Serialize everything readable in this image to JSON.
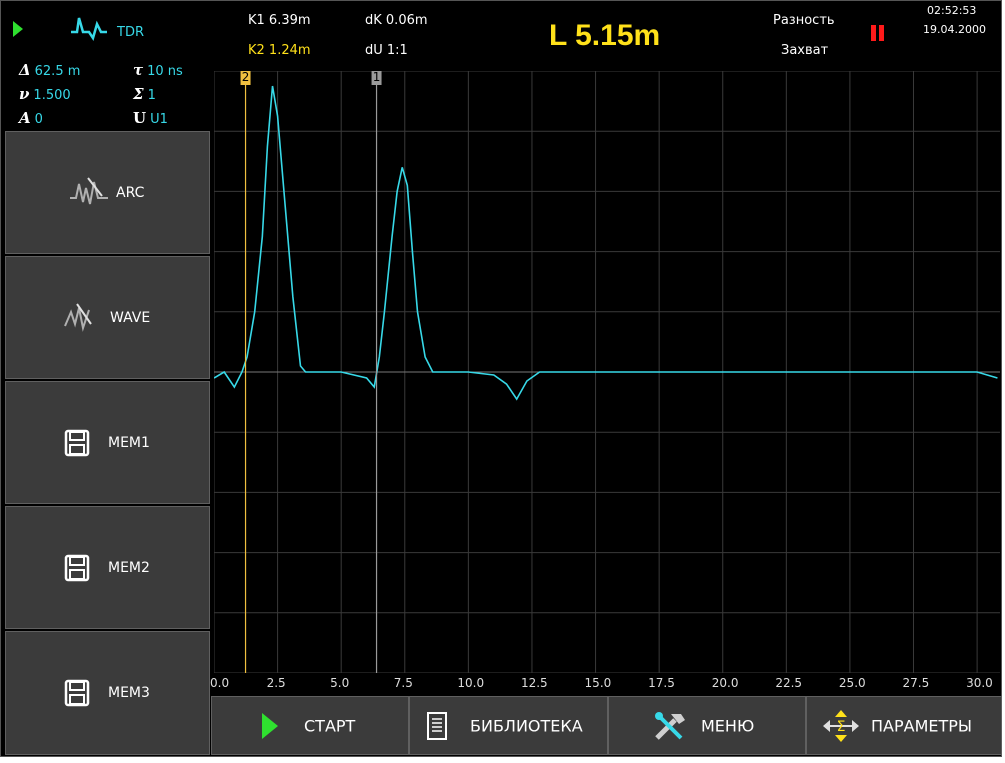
{
  "status": {
    "mode": "TDR",
    "delta": "62.5 m",
    "tau": "10 ns",
    "v": "1.500",
    "sigma": "1",
    "a": "0",
    "u": "U1"
  },
  "side_buttons": [
    {
      "label": "ARC",
      "icon": "arc-wave-icon"
    },
    {
      "label": "WAVE",
      "icon": "wave-icon"
    },
    {
      "label": "MEM1",
      "icon": "floppy-disk-icon"
    },
    {
      "label": "MEM2",
      "icon": "floppy-disk-icon"
    },
    {
      "label": "MEM3",
      "icon": "floppy-disk-icon"
    }
  ],
  "readout": {
    "k1": "K1 6.39m",
    "k2": "K2 1.24m",
    "dk": "dK 0.06m",
    "du": "dU 1:1",
    "length": "L 5.15m",
    "diff": "Разность",
    "capture": "Захват",
    "time": "02:52:53",
    "date": "19.04.2000"
  },
  "cursors": [
    {
      "label": "2",
      "x": 1.24,
      "color": "#f0c040"
    },
    {
      "label": "1",
      "x": 6.39,
      "color": "#9a9a9a"
    }
  ],
  "colors": {
    "accent": "#37d9e8",
    "length": "#ffe11a",
    "pause": "#ff1a1a",
    "play": "#2fe02f"
  },
  "bottom_buttons": [
    {
      "label": "СТАРТ",
      "icon": "play-icon"
    },
    {
      "label": "БИБЛИОТЕКА",
      "icon": "document-icon"
    },
    {
      "label": "МЕНЮ",
      "icon": "tools-icon"
    },
    {
      "label": "ПАРАМЕТРЫ",
      "icon": "move-arrows-icon"
    }
  ],
  "chart_data": {
    "type": "line",
    "x_ticks": [
      "0.0",
      "2.5",
      "5.0",
      "7.5",
      "10.0",
      "12.5",
      "15.0",
      "17.5",
      "20.0",
      "22.5",
      "25.0",
      "27.5",
      "30.0"
    ],
    "xlim": [
      0,
      30.9
    ],
    "ylim": [
      -1,
      1
    ],
    "grid": true,
    "series": [
      {
        "color": "#37d9e8",
        "x": [
          0.0,
          0.4,
          0.8,
          1.1,
          1.3,
          1.6,
          1.9,
          2.1,
          2.3,
          2.5,
          2.8,
          3.1,
          3.4,
          3.6,
          4.0,
          5.0,
          6.0,
          6.3,
          6.5,
          6.7,
          7.0,
          7.2,
          7.4,
          7.6,
          7.8,
          8.0,
          8.3,
          8.6,
          9.0,
          10.0,
          11.0,
          11.5,
          11.9,
          12.3,
          12.8,
          13.5,
          15.0,
          17.5,
          20.0,
          22.5,
          25.0,
          27.5,
          30.0,
          30.8
        ],
        "y": [
          -0.02,
          0.0,
          -0.05,
          0.0,
          0.05,
          0.2,
          0.45,
          0.75,
          0.95,
          0.85,
          0.55,
          0.25,
          0.02,
          0.0,
          0.0,
          0.0,
          -0.02,
          -0.05,
          0.05,
          0.2,
          0.45,
          0.6,
          0.68,
          0.62,
          0.4,
          0.2,
          0.05,
          0.0,
          0.0,
          0.0,
          -0.01,
          -0.04,
          -0.09,
          -0.03,
          0.0,
          0.0,
          0.0,
          0.0,
          0.0,
          0.0,
          0.0,
          0.0,
          0.0,
          -0.02
        ]
      }
    ]
  }
}
